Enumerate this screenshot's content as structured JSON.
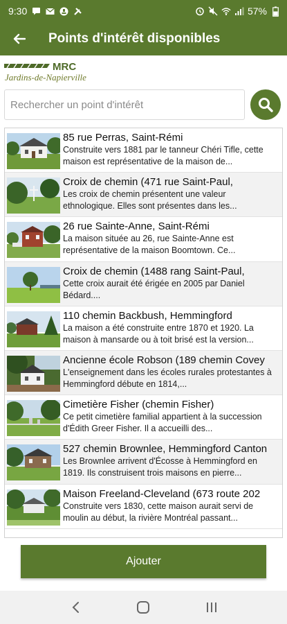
{
  "status": {
    "time": "9:30",
    "battery": "57%",
    "left_icons": [
      "message-icon",
      "mail-icon",
      "notification-circle-icon",
      "tools-icon"
    ],
    "right_icons": [
      "alarm-icon",
      "mute-icon",
      "wifi-icon",
      "signal-icon",
      "battery-icon"
    ]
  },
  "header": {
    "title": "Points d'intérêt disponibles",
    "back_icon": "arrow-left-icon"
  },
  "logo": {
    "brand": "MRC",
    "tagline": "Jardins-de-Napierville"
  },
  "search": {
    "placeholder": "Rechercher un point d'intérêt",
    "value": "",
    "button_icon": "search-icon"
  },
  "items": [
    {
      "title": "85 rue Perras, Saint-Rémi",
      "description": "Construite vers 1881 par le tanneur Chéri Tifle, cette maison est représentative de la maison de..."
    },
    {
      "title": "Croix de chemin (471 rue Saint-Paul,",
      "description": "Les croix de chemin présentent une valeur ethnologique. Elles sont présentes dans les..."
    },
    {
      "title": "26 rue Sainte-Anne, Saint-Rémi",
      "description": "La maison située au 26, rue Sainte-Anne est représentative de la maison Boomtown. Ce..."
    },
    {
      "title": "Croix de chemin (1488 rang Saint-Paul,",
      "description": "Cette croix aurait été érigée en 2005 par Daniel Bédard...."
    },
    {
      "title": "110 chemin Backbush, Hemmingford",
      "description": "La maison a été construite entre 1870 et 1920. La maison à mansarde ou à toit brisé est la version..."
    },
    {
      "title": "Ancienne école Robson (189 chemin Covey",
      "description": "L'enseignement dans les écoles rurales protestantes à Hemmingford débute en 1814,..."
    },
    {
      "title": "Cimetière Fisher (chemin Fisher)",
      "description": "Ce petit cimetière familial appartient à la succession d'Édith Greer Fisher. Il a accueilli des..."
    },
    {
      "title": "527 chemin Brownlee, Hemmingford Canton",
      "description": "Les Brownlee arrivent d'Écosse à Hemmingford en 1819. Ils construisent trois maisons en pierre..."
    },
    {
      "title": "Maison Freeland-Cleveland (673 route 202",
      "description": "Construite vers 1830, cette maison aurait servi de moulin au début, la rivière Montréal passant..."
    }
  ],
  "actions": {
    "add_label": "Ajouter"
  },
  "nav": {
    "back_icon": "nav-back-icon",
    "home_icon": "nav-home-icon",
    "recents_icon": "nav-recents-icon"
  },
  "colors": {
    "primary": "#5a7a2e",
    "list_alt_row": "#f2f2f2",
    "nav_bg": "#f1f1f1"
  }
}
